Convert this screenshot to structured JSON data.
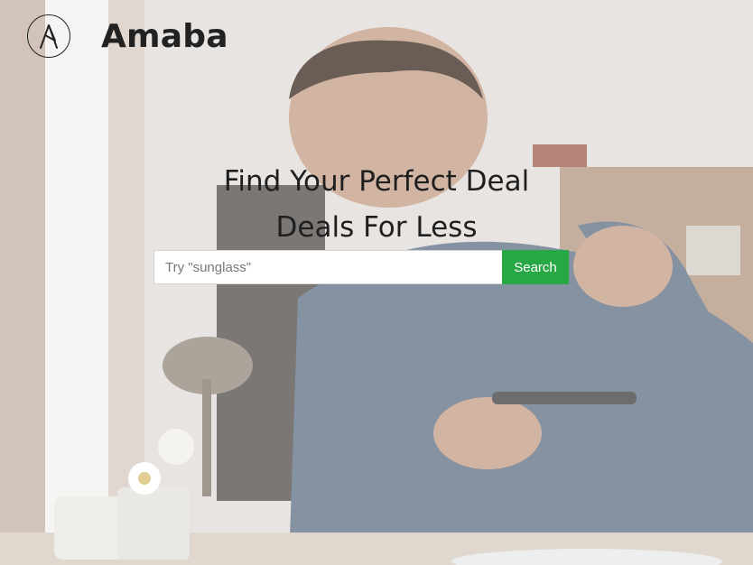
{
  "header": {
    "logo_icon": "ansible-a-logo",
    "brand": "Amaba"
  },
  "hero": {
    "title_line1": "Find Your Perfect Deal",
    "title_line2": "Deals For Less"
  },
  "search": {
    "placeholder": "Try \"sunglass\"",
    "button_label": "Search",
    "button_color": "#28a745"
  },
  "background": {
    "description_icon": "video-background"
  }
}
